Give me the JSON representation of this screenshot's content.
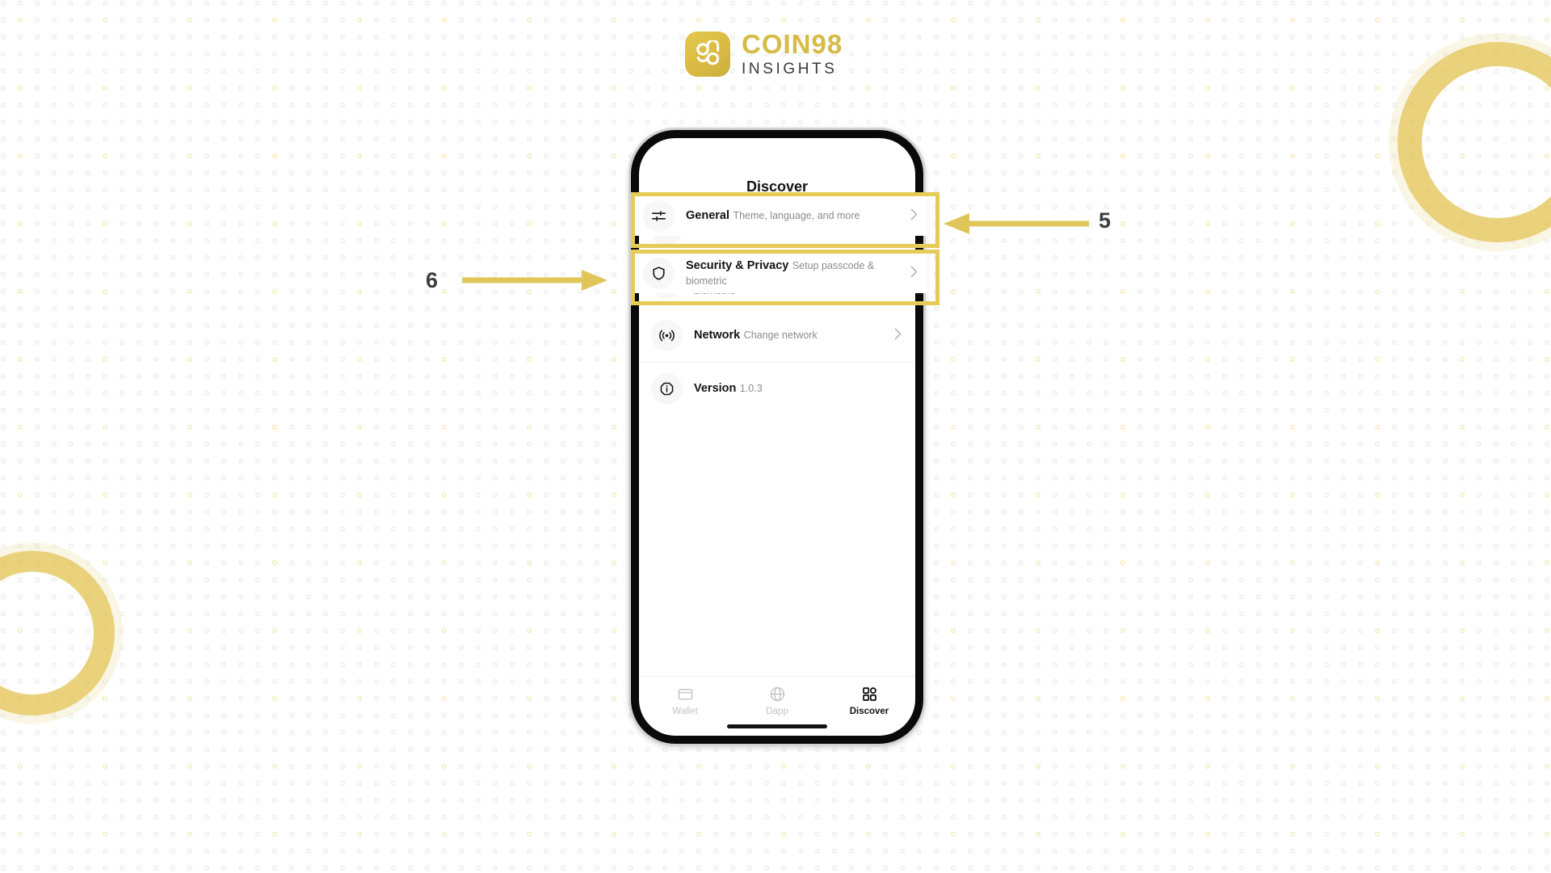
{
  "brand": {
    "logo_mark_icon": "coin98-logo-icon",
    "title": "COIN98",
    "subtitle": "INSIGHTS",
    "accent_color": "#d6bb47"
  },
  "phone": {
    "screen_title": "Discover",
    "settings": [
      {
        "icon": "sliders-icon",
        "title": "General",
        "subtitle": "Theme, language, and more",
        "chevron": "chevron-right-icon",
        "highlighted": true
      },
      {
        "icon": "shield-icon",
        "title": "Security & Privacy",
        "subtitle": "Setup passcode & biometric",
        "chevron": "chevron-right-icon",
        "highlighted": true
      },
      {
        "icon": "broadcast-icon",
        "title": "Network",
        "subtitle": "Change network",
        "chevron": "chevron-right-icon",
        "highlighted": false
      },
      {
        "icon": "info-icon",
        "title": "Version",
        "subtitle": "1.0.3",
        "chevron": "",
        "highlighted": false
      }
    ],
    "tabs": [
      {
        "icon": "wallet-icon",
        "label": "Wallet",
        "active": false
      },
      {
        "icon": "globe-icon",
        "label": "Dapp",
        "active": false
      },
      {
        "icon": "grid-icon",
        "label": "Discover",
        "active": true
      }
    ]
  },
  "annotations": [
    {
      "number": "5",
      "points_to": "General",
      "direction": "left"
    },
    {
      "number": "6",
      "points_to": "Security & Privacy",
      "direction": "right"
    }
  ],
  "theme": {
    "highlight_color": "#e5cb58",
    "arrow_color": "#e0c659",
    "ring_color": "#e2c04a",
    "background": "#ffffff"
  }
}
